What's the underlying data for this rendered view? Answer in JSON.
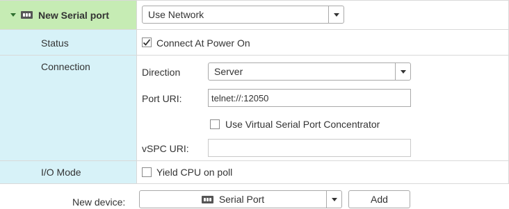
{
  "header": {
    "title": "New Serial port",
    "connection_type": "Use Network"
  },
  "status": {
    "label": "Status",
    "connect_at_power_on_label": "Connect At Power On",
    "connect_at_power_on_checked": true
  },
  "connection": {
    "label": "Connection",
    "direction_label": "Direction",
    "direction_value": "Server",
    "port_uri_label": "Port URI:",
    "port_uri_value": "telnet://:12050",
    "vspc_checkbox_label": "Use Virtual Serial Port Concentrator",
    "vspc_checked": false,
    "vspc_uri_label": "vSPC URI:",
    "vspc_uri_value": ""
  },
  "io_mode": {
    "label": "I/O Mode",
    "yield_cpu_label": "Yield CPU on poll",
    "yield_cpu_checked": false
  },
  "footer": {
    "new_device_label": "New device:",
    "device_type": "Serial Port",
    "add_button": "Add"
  },
  "icons": {
    "serial_port": "serial-port-icon",
    "expand": "expand-triangle-icon",
    "check": "checkmark-icon",
    "dropdown": "chevron-down-icon"
  },
  "colors": {
    "header_bg": "#c6ecb4",
    "label_column_bg": "#d7f2f8",
    "grid_line": "#d9d9d9"
  }
}
